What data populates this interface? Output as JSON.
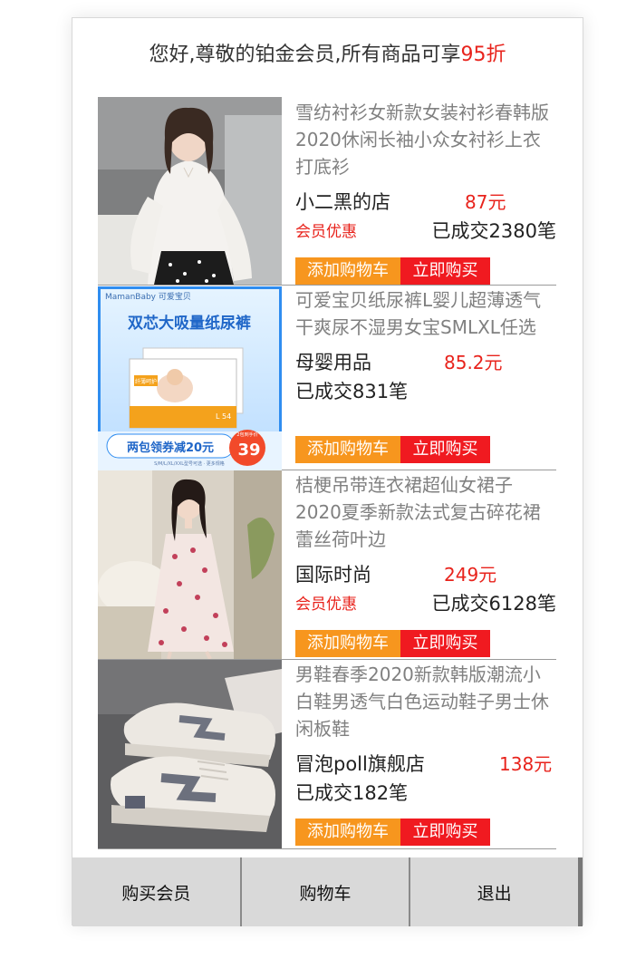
{
  "header": {
    "greeting": "您好,尊敬的铂金会员,所有商品可享",
    "discount": "95折"
  },
  "products": [
    {
      "name": "雪纺衬衫女新款女装衬衫春韩版2020休闲长袖小众女衬衫上衣打底衫",
      "shop": "小二黑的店",
      "price": "87元",
      "badge": "会员优惠",
      "sold": "已成交2380笔",
      "add_cart": "添加购物车",
      "buy_now": "立即购买"
    },
    {
      "name": "可爱宝贝纸尿裤L婴儿超薄透气干爽尿不湿男女宝SMLXL任选",
      "shop": "母婴用品",
      "price": "85.2元",
      "sold": "已成交831笔",
      "add_cart": "添加购物车",
      "buy_now": "立即购买",
      "image_text": {
        "brand": "MamanBaby 可爱宝贝",
        "title": "双芯大吸量纸尿裤",
        "package": "纤薄呵护",
        "size": "L 54",
        "promo": "两包领券减20元",
        "price_badge": "39",
        "price_badge_caption": "2包到手价",
        "footnote": "S/M/L/XL/XXL型号可选 · 更多规格"
      }
    },
    {
      "name": "桔梗吊带连衣裙超仙女裙子2020夏季新款法式复古碎花裙蕾丝荷叶边",
      "shop": "国际时尚",
      "price": "249元",
      "badge": "会员优惠",
      "sold": "已成交6128笔",
      "add_cart": "添加购物车",
      "buy_now": "立即购买"
    },
    {
      "name": "男鞋春季2020新款韩版潮流小白鞋男透气白色运动鞋子男士休闲板鞋",
      "shop": "冒泡poll旗舰店",
      "price": "138元",
      "sold": "已成交182笔",
      "add_cart": "添加购物车",
      "buy_now": "立即购买"
    }
  ],
  "footer": {
    "tabs": [
      "购买会员",
      "购物车",
      "退出"
    ]
  },
  "colors": {
    "accent_red": "#e8231c",
    "cart_orange": "#f7961e",
    "buy_red": "#f01a20",
    "tab_bg": "#d9d9d9"
  }
}
